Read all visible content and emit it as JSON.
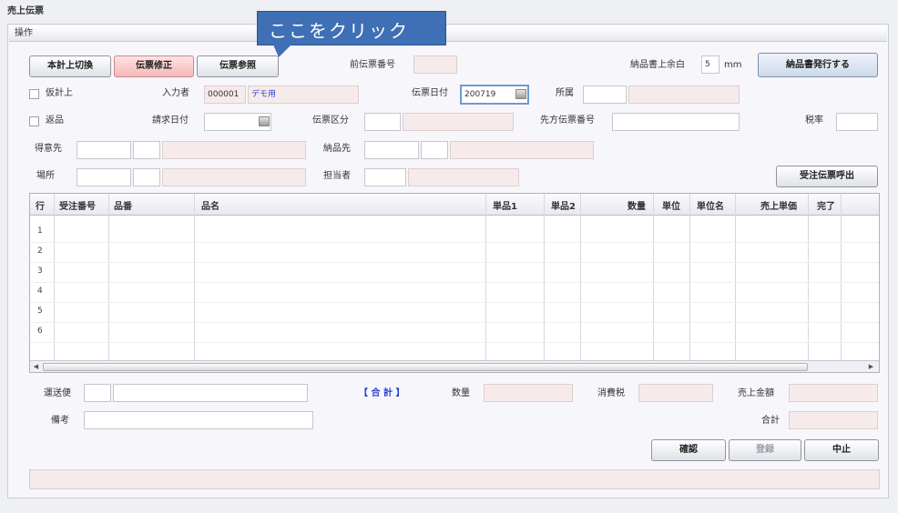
{
  "window": {
    "title": "売上伝票",
    "group_label": "操作"
  },
  "callout": {
    "text": "ここをクリック"
  },
  "toolbar": {
    "btn_switch": "本計上切換",
    "btn_fix": "伝票修正",
    "btn_ref": "伝票参照",
    "btn_issue": "納品書発行する",
    "orig_no_label": "前伝票番号",
    "print_label": "納品書上余白",
    "print_value": "5",
    "print_unit": "mm"
  },
  "form": {
    "chk_provisional": "仮計上",
    "chk_return": "返品",
    "entry_person_label": "入力者",
    "entry_person_code": "000001",
    "entry_person_name": "デモ用",
    "slip_date_label": "伝票日付",
    "slip_date_value": "200719",
    "dept_label": "所属",
    "billing_date_label": "請求日付",
    "slip_type_label": "伝票区分",
    "partner_slip_label": "先方伝票番号",
    "tax_rate_label": "税率",
    "order_from_label": "得意先",
    "delivery_to_label": "納品先",
    "location_label": "場所",
    "person_label": "担当者",
    "btn_order_call": "受注伝票呼出"
  },
  "grid": {
    "columns": [
      "行",
      "受注番号",
      "品番",
      "品名",
      "単品1",
      "単品2",
      "数量",
      "単位",
      "単位名",
      "売上単価",
      "完了"
    ],
    "rows": [
      "1",
      "2",
      "3",
      "4",
      "5",
      "6"
    ]
  },
  "footer": {
    "shipping_label": "運送便",
    "memo_label": "備考",
    "total_title": "【 合 計 】",
    "qty_label": "数量",
    "tax_label": "消費税",
    "sales_amount_label": "売上金額",
    "sum_label": "合計",
    "btn_confirm": "確認",
    "btn_register": "登録",
    "btn_cancel": "中止"
  }
}
